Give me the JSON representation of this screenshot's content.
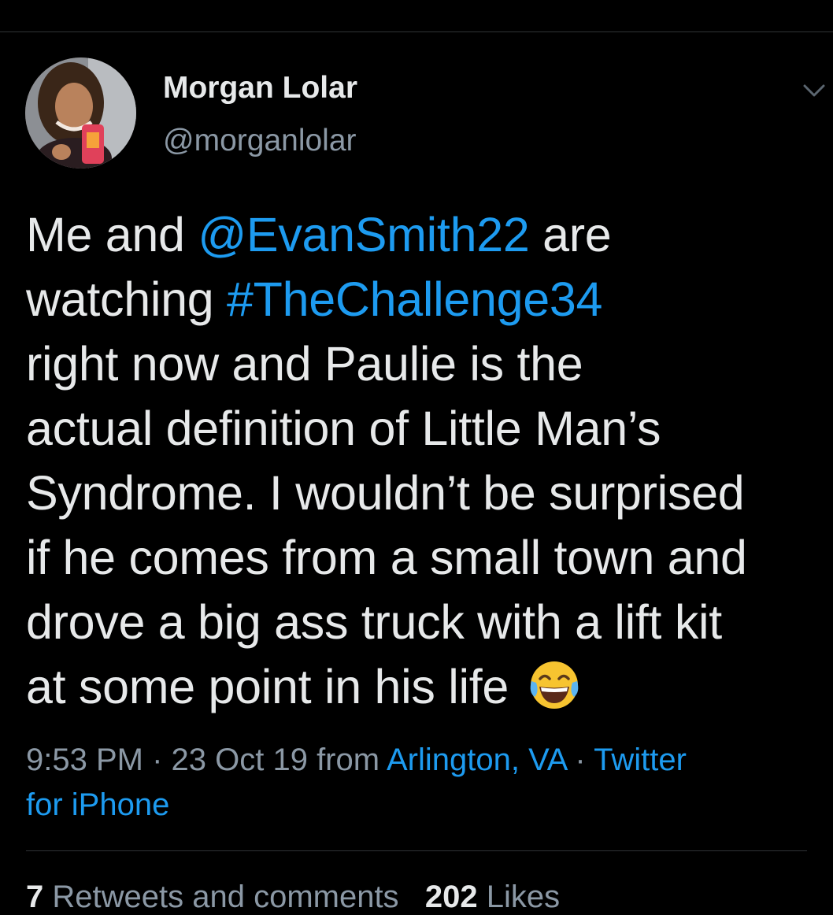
{
  "colors": {
    "background": "#000000",
    "text": "#e7e9ea",
    "muted": "#8b98a5",
    "link": "#1d9bf0",
    "divider": "#2f3336"
  },
  "author": {
    "name": "Morgan Lolar",
    "handle": "@morganlolar",
    "avatar_icon": "profile-photo"
  },
  "menu_icon": "chevron-down-icon",
  "tweet": {
    "line1": {
      "pre": "Me and ",
      "mention": "@EvanSmith22",
      "post": " are"
    },
    "line2": {
      "pre": "watching ",
      "hashtag": "#TheChallenge34"
    },
    "line3": "right now and Paulie is the",
    "line4": "actual definition of Little Man’s",
    "line5": "Syndrome. I wouldn’t be surprised",
    "line6": "if he comes from a small town and",
    "line7": "drove a big ass truck with a lift kit",
    "line8": "at some point in his life ",
    "emoji_icon": "face-with-tears-of-joy-icon"
  },
  "meta": {
    "time": "9:53 PM",
    "separator": " · ",
    "date": "23 Oct 19",
    "from": " from ",
    "location": "Arlington, VA",
    "source_part1": "Twitter",
    "source_part2": "for iPhone"
  },
  "stats": {
    "retweets_count": "7",
    "retweets_label": " Retweets and comments",
    "likes_count": "202",
    "likes_label": " Likes"
  }
}
